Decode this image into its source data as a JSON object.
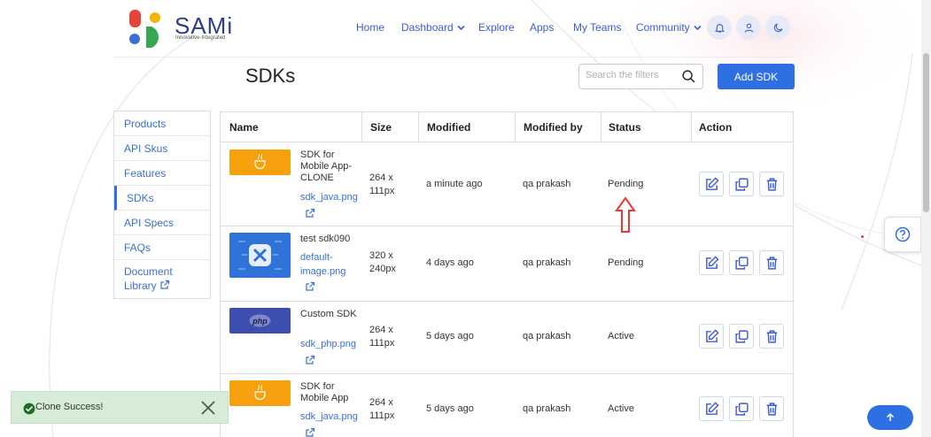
{
  "brand": {
    "name": "SAMi",
    "tagline": "Innovative-Integrated"
  },
  "nav": [
    {
      "label": "Home",
      "dropdown": false
    },
    {
      "label": "Dashboard",
      "dropdown": true
    },
    {
      "label": "Explore",
      "dropdown": false
    },
    {
      "label": "Apps",
      "dropdown": false
    },
    {
      "label": "My Teams",
      "dropdown": false
    },
    {
      "label": "Community",
      "dropdown": true
    }
  ],
  "header_icons": [
    "bell-icon",
    "user-icon",
    "moon-icon"
  ],
  "page": {
    "title": "SDKs",
    "search_placeholder": "Search the filters",
    "add_button": "Add SDK"
  },
  "sidebar": {
    "items": [
      {
        "label": "Products",
        "active": false
      },
      {
        "label": "API Skus",
        "active": false
      },
      {
        "label": "Features",
        "active": false
      },
      {
        "label": "SDKs",
        "active": true
      },
      {
        "label": "API Specs",
        "active": false
      },
      {
        "label": "FAQs",
        "active": false
      },
      {
        "label": "Document Library",
        "active": false,
        "external": true
      }
    ]
  },
  "table": {
    "columns": [
      "Name",
      "Size",
      "Modified",
      "Modified by",
      "Status",
      "Action"
    ],
    "rows": [
      {
        "name": "SDK for Mobile App-CLONE",
        "file": "sdk_java.png",
        "thumb": "java",
        "size": "264 x 111px",
        "modified": "a minute ago",
        "modified_by": "qa prakash",
        "status": "Pending"
      },
      {
        "name": "test sdk090",
        "file": "default-image.png",
        "thumb": "default",
        "size": "320 x 240px",
        "modified": "4 days ago",
        "modified_by": "qa prakash",
        "status": "Pending"
      },
      {
        "name": "Custom SDK",
        "file": "sdk_php.png",
        "thumb": "php",
        "size": "264 x 111px",
        "modified": "5 days ago",
        "modified_by": "qa prakash",
        "status": "Active"
      },
      {
        "name": "SDK for Mobile App",
        "file": "sdk_java.png",
        "thumb": "java",
        "size": "264 x 111px",
        "modified": "5 days ago",
        "modified_by": "qa prakash",
        "status": "Active"
      }
    ],
    "actions": [
      "edit-icon",
      "clone-icon",
      "delete-icon"
    ]
  },
  "thumb_labels": {
    "php": "php"
  },
  "toast": {
    "message": "Clone Success!"
  },
  "colors": {
    "accent": "#2f6fe4",
    "java_thumb": "#f5a00c",
    "php_thumb": "#3d4fae",
    "default_thumb": "#2f73d9",
    "toast_bg": "#d6ecd7",
    "annotation_arrow": "#e53935"
  }
}
